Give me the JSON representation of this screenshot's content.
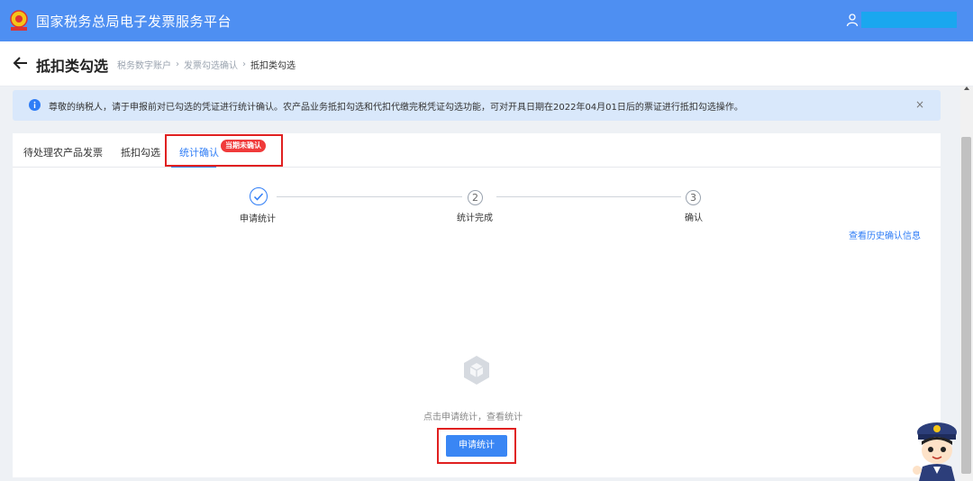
{
  "app": {
    "title": "国家税务总局电子发票服务平台"
  },
  "header": {
    "page_title": "抵扣类勾选",
    "breadcrumb": [
      "税务数字账户",
      "发票勾选确认",
      "抵扣类勾选"
    ],
    "breadcrumb_sep": "›"
  },
  "notice": {
    "text": "尊敬的纳税人，请于申报前对已勾选的凭证进行统计确认。农产品业务抵扣勾选和代扣代缴完税凭证勾选功能，可对开具日期在2022年04月01日后的票证进行抵扣勾选操作。",
    "close": "×"
  },
  "tabs": [
    {
      "label": "待处理农产品发票"
    },
    {
      "label": "抵扣勾选"
    },
    {
      "label": "统计确认",
      "badge": "当期未确认",
      "active": true
    }
  ],
  "steps": [
    {
      "number": "1",
      "label": "申请统计",
      "done": true
    },
    {
      "number": "2",
      "label": "统计完成"
    },
    {
      "number": "3",
      "label": "确认"
    }
  ],
  "history_link": "查看历史确认信息",
  "empty": {
    "text": "点击申请统计，查看统计",
    "button": "申请统计"
  },
  "colors": {
    "topbar": "#4e8ff2",
    "accent": "#2f7df6",
    "badge": "#f03a3a",
    "highlight": "#e02020"
  }
}
